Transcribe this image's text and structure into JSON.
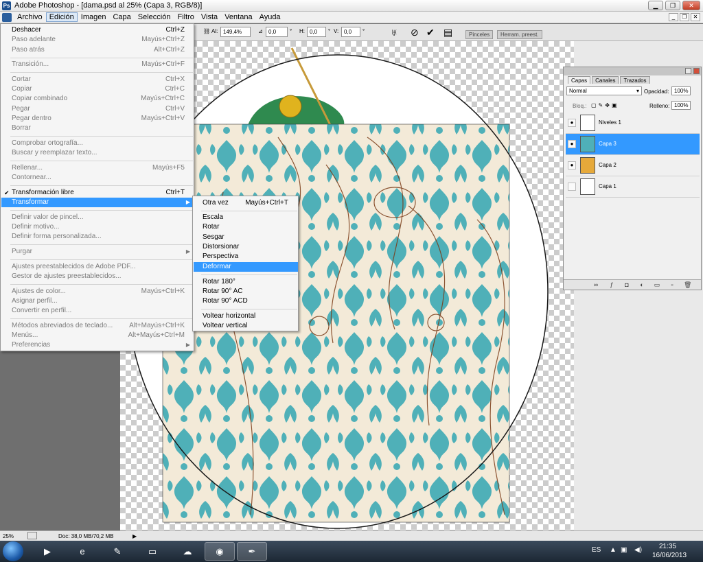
{
  "window": {
    "title": "Adobe Photoshop - [dama.psd al 25% (Capa 3, RGB/8)]",
    "logo": "Ps"
  },
  "menubar": [
    "Archivo",
    "Edición",
    "Imagen",
    "Capa",
    "Selección",
    "Filtro",
    "Vista",
    "Ventana",
    "Ayuda"
  ],
  "options": {
    "al_label": "Al:",
    "al_value": "149,4%",
    "angle_value": "0,0",
    "h_label": "H:",
    "h_value": "0,0",
    "v_label": "V:",
    "v_value": "0,0",
    "tab1": "Pinceles",
    "tab2": "Herram. preest."
  },
  "edit_menu": [
    {
      "label": "Deshacer",
      "shortcut": "Ctrl+Z",
      "disabled": false
    },
    {
      "label": "Paso adelante",
      "shortcut": "Mayús+Ctrl+Z",
      "disabled": true
    },
    {
      "label": "Paso atrás",
      "shortcut": "Alt+Ctrl+Z",
      "disabled": true
    },
    {
      "label": "Transición...",
      "shortcut": "Mayús+Ctrl+F",
      "disabled": true
    },
    {
      "label": "Cortar",
      "shortcut": "Ctrl+X",
      "disabled": true
    },
    {
      "label": "Copiar",
      "shortcut": "Ctrl+C",
      "disabled": true
    },
    {
      "label": "Copiar combinado",
      "shortcut": "Mayús+Ctrl+C",
      "disabled": true
    },
    {
      "label": "Pegar",
      "shortcut": "Ctrl+V",
      "disabled": true
    },
    {
      "label": "Pegar dentro",
      "shortcut": "Mayús+Ctrl+V",
      "disabled": true
    },
    {
      "label": "Borrar",
      "shortcut": "",
      "disabled": true
    },
    {
      "label": "Comprobar ortografía...",
      "shortcut": "",
      "disabled": true
    },
    {
      "label": "Buscar y reemplazar texto...",
      "shortcut": "",
      "disabled": true
    },
    {
      "label": "Rellenar...",
      "shortcut": "Mayús+F5",
      "disabled": true
    },
    {
      "label": "Contornear...",
      "shortcut": "",
      "disabled": true
    },
    {
      "label": "Transformación libre",
      "shortcut": "Ctrl+T",
      "disabled": false
    },
    {
      "label": "Transformar",
      "shortcut": "",
      "disabled": false
    },
    {
      "label": "Definir valor de pincel...",
      "shortcut": "",
      "disabled": true
    },
    {
      "label": "Definir motivo...",
      "shortcut": "",
      "disabled": true
    },
    {
      "label": "Definir forma personalizada...",
      "shortcut": "",
      "disabled": true
    },
    {
      "label": "Purgar",
      "shortcut": "",
      "disabled": true
    },
    {
      "label": "Ajustes preestablecidos de Adobe PDF...",
      "shortcut": "",
      "disabled": true
    },
    {
      "label": "Gestor de ajustes preestablecidos...",
      "shortcut": "",
      "disabled": true
    },
    {
      "label": "Ajustes de color...",
      "shortcut": "Mayús+Ctrl+K",
      "disabled": true
    },
    {
      "label": "Asignar perfil...",
      "shortcut": "",
      "disabled": true
    },
    {
      "label": "Convertir en perfil...",
      "shortcut": "",
      "disabled": true
    },
    {
      "label": "Métodos abreviados de teclado...",
      "shortcut": "Alt+Mayús+Ctrl+K",
      "disabled": true
    },
    {
      "label": "Menús...",
      "shortcut": "Alt+Mayús+Ctrl+M",
      "disabled": true
    },
    {
      "label": "Preferencias",
      "shortcut": "",
      "disabled": true
    }
  ],
  "transform_menu": [
    {
      "label": "Otra vez",
      "shortcut": "Mayús+Ctrl+T"
    },
    {
      "label": "Escala",
      "shortcut": ""
    },
    {
      "label": "Rotar",
      "shortcut": ""
    },
    {
      "label": "Sesgar",
      "shortcut": ""
    },
    {
      "label": "Distorsionar",
      "shortcut": ""
    },
    {
      "label": "Perspectiva",
      "shortcut": ""
    },
    {
      "label": "Deformar",
      "shortcut": ""
    },
    {
      "label": "Rotar 180°",
      "shortcut": ""
    },
    {
      "label": "Rotar 90° AC",
      "shortcut": ""
    },
    {
      "label": "Rotar 90° ACD",
      "shortcut": ""
    },
    {
      "label": "Voltear horizontal",
      "shortcut": ""
    },
    {
      "label": "Voltear vertical",
      "shortcut": ""
    }
  ],
  "layers_panel": {
    "tabs": [
      "Capas",
      "Canales",
      "Trazados"
    ],
    "blend_mode": "Normal",
    "opacity_label": "Opacidad:",
    "opacity_value": "100%",
    "lock_label": "Bloq.:",
    "fill_label": "Relleno:",
    "fill_value": "100%",
    "layers": [
      {
        "name": "Niveles 1",
        "visible": true,
        "selected": false
      },
      {
        "name": "Capa 3",
        "visible": true,
        "selected": true
      },
      {
        "name": "Capa 2",
        "visible": true,
        "selected": false
      },
      {
        "name": "Capa 1",
        "visible": false,
        "selected": false
      }
    ]
  },
  "status": {
    "zoom": "25%",
    "doc": "Doc: 38,0 MB/70,2 MB"
  },
  "taskbar": {
    "lang": "ES",
    "time": "21:35",
    "date": "16/06/2013"
  },
  "colors": {
    "highlight": "#3399ff",
    "pattern": "#4fb0b8",
    "pattern_bg": "#f3ead8"
  }
}
